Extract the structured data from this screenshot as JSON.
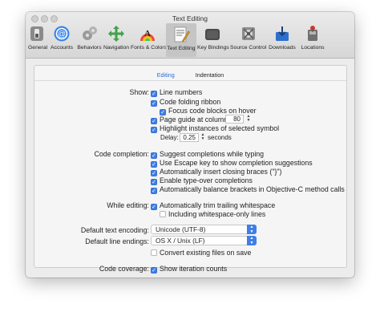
{
  "window": {
    "title": "Text Editing"
  },
  "toolbar": {
    "items": [
      {
        "label": "General",
        "icon": "general-switch-icon"
      },
      {
        "label": "Accounts",
        "icon": "accounts-at-icon"
      },
      {
        "label": "Behaviors",
        "icon": "behaviors-gears-icon"
      },
      {
        "label": "Navigation",
        "icon": "navigation-arrows-icon"
      },
      {
        "label": "Fonts & Colors",
        "icon": "fonts-colors-icon"
      },
      {
        "label": "Text Editing",
        "icon": "text-editing-icon",
        "active": true
      },
      {
        "label": "Key Bindings",
        "icon": "key-bindings-icon"
      },
      {
        "label": "Source Control",
        "icon": "source-control-icon"
      },
      {
        "label": "Downloads",
        "icon": "downloads-icon"
      },
      {
        "label": "Locations",
        "icon": "locations-icon"
      }
    ]
  },
  "tabs": [
    {
      "label": "Editing",
      "active": true
    },
    {
      "label": "Indentation",
      "active": false
    }
  ],
  "show": {
    "label": "Show:",
    "line_numbers": {
      "label": "Line numbers",
      "checked": true
    },
    "code_folding": {
      "label": "Code folding ribbon",
      "checked": true
    },
    "focus_blocks": {
      "label": "Focus code blocks on hover",
      "checked": true
    },
    "page_guide": {
      "label": "Page guide at column:",
      "checked": true,
      "value": "80"
    },
    "highlight": {
      "label": "Highlight instances of selected symbol",
      "checked": true
    },
    "delay": {
      "label": "Delay:",
      "value": "0.25",
      "unit": "seconds"
    }
  },
  "code_completion": {
    "label": "Code completion:",
    "items": [
      {
        "label": "Suggest completions while typing",
        "checked": true
      },
      {
        "label": "Use Escape key to show completion suggestions",
        "checked": true
      },
      {
        "label": "Automatically insert closing braces (\"}\")",
        "checked": true
      },
      {
        "label": "Enable type-over completions",
        "checked": true
      },
      {
        "label": "Automatically balance brackets in Objective-C method calls",
        "checked": true
      }
    ]
  },
  "while_editing": {
    "label": "While editing:",
    "trim": {
      "label": "Automatically trim trailing whitespace",
      "checked": true
    },
    "whitespace_only": {
      "label": "Including whitespace-only lines",
      "checked": false
    }
  },
  "encoding": {
    "label": "Default text encoding:",
    "value": "Unicode (UTF-8)"
  },
  "line_endings": {
    "label": "Default line endings:",
    "value": "OS X / Unix (LF)"
  },
  "convert": {
    "label": "Convert existing files on save",
    "checked": false
  },
  "coverage": {
    "label": "Code coverage:",
    "show": {
      "label": "Show iteration counts",
      "checked": true
    }
  },
  "colors": {
    "accent": "#3f7fe6",
    "selected_tab": "#2a6ad8"
  }
}
